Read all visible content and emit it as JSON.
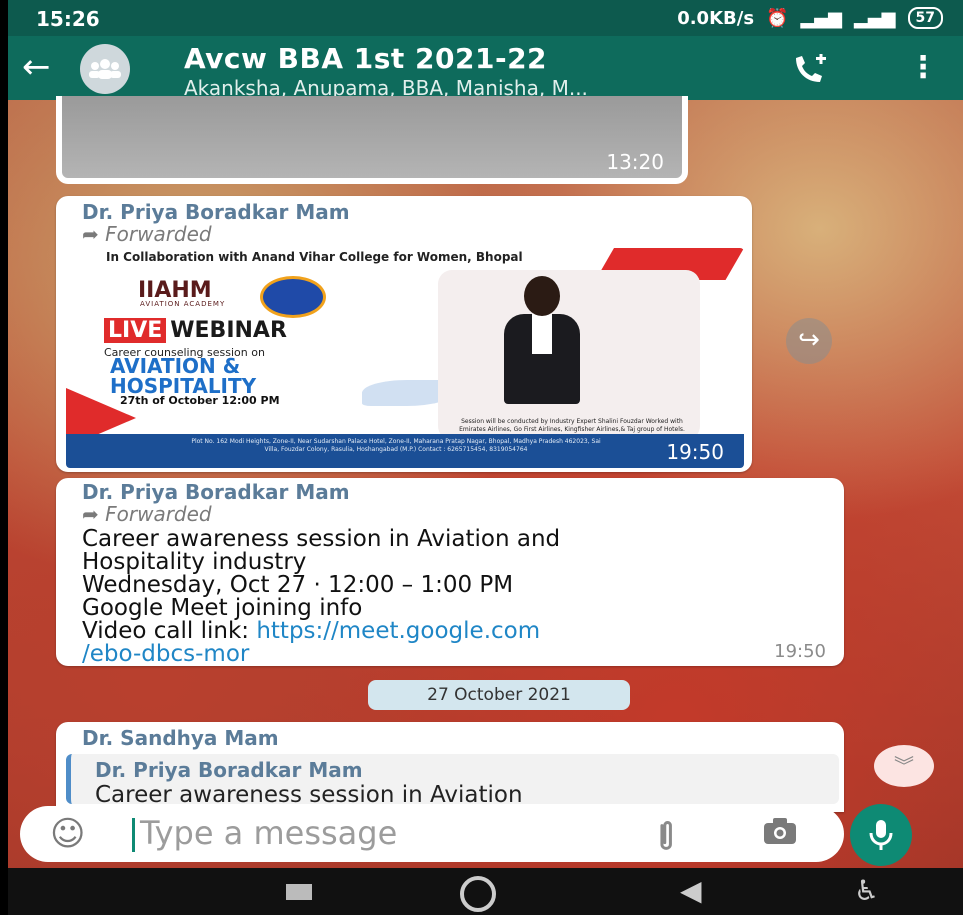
{
  "status_bar": {
    "time": "15:26",
    "speed": "0.0KB/s",
    "battery": "57"
  },
  "header": {
    "back_icon": "←",
    "title": "Avcw BBA 1st 2021-22",
    "subtitle": "Akanksha, Anupama, BBA, Manisha, M...",
    "add_call_icon": "📞+",
    "menu_icon": "⋮"
  },
  "messages": [
    {
      "type": "media",
      "time": "13:20"
    },
    {
      "type": "image",
      "sender": "Dr. Priya Boradkar Mam",
      "forwarded": "Forwarded",
      "time": "19:50",
      "poster": {
        "top": "In Collaboration with Anand Vihar College for Women, Bhopal",
        "logo": "IIAHM",
        "logo_sub": "AVIATION ACADEMY",
        "live": "LIVE",
        "webinar": "WEBINAR",
        "career": "Career counseling session on",
        "aviation": "AVIATION &",
        "hospitality": "HOSPITALITY",
        "date": "27th of October 12:00 PM",
        "speaker": "Session will be conducted by Industry Expert Shalini Fouzdar Worked with Emirates Airlines, Go First Airlines, Kingfisher Airlines,& Taj group of Hotels.",
        "footer": "Plot No. 162 Modi Heights, Zone-II, Near Sudarshan Palace Hotel, Zone-II, Maharana Pratap Nagar, Bhopal, Madhya Pradesh 462023, Sai Villa, Fouzdar Colony, Rasulia, Hoshangabad (M.P.) Contact : 6265715454, 8319054764"
      }
    },
    {
      "type": "text",
      "sender": "Dr. Priya Boradkar Mam",
      "forwarded": "Forwarded",
      "line1": "Career awareness session in Aviation and",
      "line2": "Hospitality industry",
      "line3": "Wednesday, Oct 27  ·  12:00 – 1:00 PM",
      "line4": "Google Meet joining info",
      "line5_label": "Video call link: ",
      "link1": "https://meet.google.com",
      "link2": "/ebo-dbcs-mor",
      "time": "19:50"
    }
  ],
  "date_chip": "27 October 2021",
  "reply": {
    "sender": "Dr. Sandhya Mam",
    "quoted_sender": "Dr. Priya Boradkar Mam",
    "quoted_text": "Career awareness session in Aviation"
  },
  "input": {
    "placeholder": "Type a message"
  },
  "icons": {
    "emoji": "☺",
    "attach": "📎",
    "camera": "📷",
    "mic": "🎤",
    "scroll_down": "︾",
    "share": "↪",
    "nav_back": "◀",
    "nav_accessibility": "♿"
  },
  "colors": {
    "header": "#0e6b5c",
    "accent": "#0e8a74",
    "link": "#1f86c6"
  }
}
